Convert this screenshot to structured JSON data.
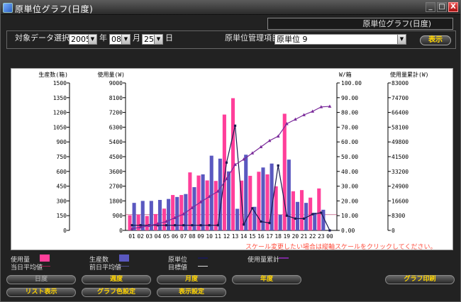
{
  "window": {
    "title": "原単位グラフ(日度)",
    "min": "_",
    "max": "□",
    "close": "X"
  },
  "header": {
    "label": "原単位グラフ(日度)"
  },
  "filter": {
    "target_label": "対象データ選択",
    "year": "2005",
    "year_unit": "年",
    "month": "08",
    "month_unit": "月",
    "day": "25",
    "day_unit": "日",
    "item_label": "原単位管理項目",
    "item_value": "原単位 9",
    "show_button": "表示"
  },
  "chart_data": {
    "type": "bar",
    "axes": {
      "production": {
        "title": "生産数(箱)",
        "ticks": [
          "1500",
          "1350",
          "1200",
          "1050",
          "900",
          "750",
          "600",
          "450",
          "300",
          "150",
          "0"
        ]
      },
      "usage": {
        "title": "使用量(W)",
        "ticks": [
          "9000",
          "8100",
          "7200",
          "6300",
          "5400",
          "4500",
          "3600",
          "2700",
          "1800",
          "900",
          "0"
        ]
      },
      "unit": {
        "title": "W/箱",
        "ticks": [
          "100.00",
          "90.00",
          "80.00",
          "70.00",
          "60.00",
          "50.00",
          "40.00",
          "30.00",
          "20.00",
          "10.00",
          "0.00"
        ]
      },
      "cumulative": {
        "title": "使用量累計(W)",
        "ticks": [
          "83000",
          "74700",
          "66400",
          "58100",
          "49800",
          "41500",
          "33200",
          "24900",
          "16600",
          "8300",
          "0"
        ]
      }
    },
    "categories": [
      "01",
      "02",
      "03",
      "04",
      "05",
      "06",
      "07",
      "08",
      "09",
      "10",
      "11",
      "12",
      "13",
      "14",
      "15",
      "16",
      "17",
      "18",
      "19",
      "20",
      "21",
      "22",
      "23",
      "00"
    ],
    "ylim": [
      0,
      9000
    ],
    "series": [
      {
        "name": "使用量",
        "axis": "usage",
        "color": "#ff3f9a",
        "values": [
          920,
          950,
          880,
          1000,
          1330,
          2160,
          2160,
          3540,
          3350,
          3050,
          3020,
          7070,
          8070,
          3040,
          3330,
          3580,
          3420,
          2690,
          7120,
          2390,
          2460,
          2000,
          2560,
          0
        ]
      },
      {
        "name": "生産数",
        "axis": "production",
        "color": "#5a58c0",
        "values": [
          280,
          300,
          300,
          310,
          320,
          340,
          370,
          440,
          570,
          760,
          730,
          600,
          220,
          770,
          240,
          640,
          680,
          160,
          720,
          290,
          280,
          180,
          210,
          0
        ]
      },
      {
        "name": "原単位",
        "axis": "unit",
        "color": "#1a1a50",
        "values": [
          3.5,
          3.5,
          3.5,
          3.5,
          3.5,
          3.5,
          3.5,
          3.5,
          3.5,
          3.5,
          3.5,
          46.0,
          71.0,
          4.0,
          15.0,
          6.0,
          5.0,
          44.0,
          10.0,
          8.0,
          8.0,
          11.0,
          12.0,
          0.0
        ]
      },
      {
        "name": "使用量累計",
        "axis": "cumulative",
        "color": "#7a2a9a",
        "values": [
          900,
          1800,
          2700,
          3700,
          5000,
          7100,
          9200,
          12700,
          16000,
          19000,
          22000,
          29000,
          37000,
          40000,
          43500,
          47000,
          50500,
          53000,
          60000,
          62500,
          65000,
          67000,
          69500,
          69800
        ]
      }
    ],
    "avg_today": 960,
    "grid": false,
    "note": "スケール変更したい場合は縦軸スケールをクリックしてください。"
  },
  "legend": {
    "usage": "使用量",
    "avg_today": "当日平均値",
    "production": "生産数",
    "avg_prev": "前日平均値",
    "unit": "原単位",
    "target": "目標値",
    "cumulative": "使用量累計"
  },
  "buttons": {
    "day": "日度",
    "week": "週度",
    "month": "月度",
    "year": "年度",
    "print": "グラフ印刷",
    "list": "リスト表示",
    "color": "グラフ色設定",
    "display": "表示設定"
  }
}
